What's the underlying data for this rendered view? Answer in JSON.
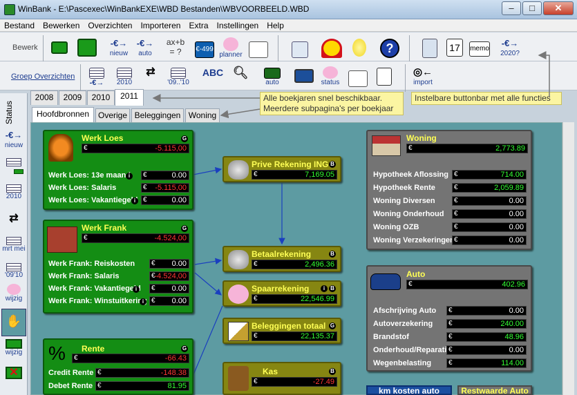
{
  "window": {
    "title": "WinBank - E:\\Pascexec\\WinBankEXE\\WBD Bestanden\\WBVOORBEELD.WBD"
  },
  "menu": [
    "Bestand",
    "Bewerken",
    "Overzichten",
    "Importeren",
    "Extra",
    "Instellingen",
    "Help"
  ],
  "toolbar1": {
    "label": "Bewerk",
    "nieuw": "nieuw",
    "auto": "auto",
    "formula": "ax+b = ?",
    "planner": "planner",
    "ebadge": "€-499",
    "year": "2020?"
  },
  "toolbar2": {
    "label": "Groep Overzichten",
    "y2010": "2010",
    "y0910": "'09..'10",
    "abc": "ABC",
    "auto": "auto",
    "status": "status",
    "import": "import",
    "calendar": "17",
    "memo": "memo"
  },
  "sidebar": {
    "status": "Status",
    "nieuw": "nieuw",
    "y2010": "2010",
    "mrt": "mrt",
    "mei": "mei",
    "y09": "'09",
    "y10": "'10",
    "wijzig1": "wijzig",
    "wijzig2": "wijzig"
  },
  "year_tabs": [
    "2008",
    "2009",
    "2010",
    "2011"
  ],
  "page_tabs": [
    "Hoofdbronnen",
    "Overige",
    "Beleggingen",
    "Woning"
  ],
  "callouts": {
    "c1a": "Alle boekjaren snel beschikbaar.",
    "c1b": "Meerdere subpagina's per boekjaar",
    "c2": "Instelbare buttonbar met alle functies"
  },
  "euro": "€",
  "werk_loes": {
    "title": "Werk Loes",
    "total": "-5.115,00",
    "rows": [
      {
        "label": "Werk Loes: 13e maand",
        "value": "0.00"
      },
      {
        "label": "Werk Loes: Salaris",
        "value": "-5.115,00"
      },
      {
        "label": "Werk Loes: Vakantiegeld",
        "value": "0.00"
      }
    ]
  },
  "werk_frank": {
    "title": "Werk Frank",
    "total": "-4.524,00",
    "rows": [
      {
        "label": "Werk Frank: Reiskosten",
        "value": "0.00"
      },
      {
        "label": "Werk Frank: Salaris",
        "value": "-4.524,00"
      },
      {
        "label": "Werk Frank: Vakantiegeld",
        "value": "0.00"
      },
      {
        "label": "Werk Frank: Winstuitkering",
        "value": "0.00"
      }
    ]
  },
  "rente": {
    "title": "Rente",
    "symbol": "%",
    "total": "-66.43",
    "rows": [
      {
        "label": "Credit Rente",
        "value": "-148.38"
      },
      {
        "label": "Debet Rente",
        "value": "81.95"
      }
    ]
  },
  "prive": {
    "title": "Prive Rekening ING",
    "value": "7,169.05"
  },
  "betaal": {
    "title": "Betaalrekening",
    "value": "2,496.36"
  },
  "spaar": {
    "title": "Spaarrekening",
    "value": "22,546.99"
  },
  "beleg": {
    "title": "Beleggingen totaal",
    "value": "22,135.37"
  },
  "kas": {
    "title": "Kas",
    "value": "-27.49"
  },
  "woning": {
    "title": "Woning",
    "total": "2,773.89",
    "rows": [
      {
        "label": "Hypotheek Aflossing",
        "value": "714.00"
      },
      {
        "label": "Hypotheek Rente",
        "value": "2,059.89"
      },
      {
        "label": "Woning Diversen",
        "value": "0.00"
      },
      {
        "label": "Woning Onderhoud",
        "value": "0.00"
      },
      {
        "label": "Woning OZB",
        "value": "0.00"
      },
      {
        "label": "Woning Verzekeringen",
        "value": "0.00"
      }
    ]
  },
  "auto": {
    "title": "Auto",
    "total": "402.96",
    "rows": [
      {
        "label": "Afschrijving Auto",
        "value": "0.00"
      },
      {
        "label": "Autoverzekering",
        "value": "240.00"
      },
      {
        "label": "Brandstof",
        "value": "48.96"
      },
      {
        "label": "Onderhoud/Reparatie",
        "value": "0.00"
      },
      {
        "label": "Wegenbelasting",
        "value": "114.00"
      }
    ]
  },
  "buttons": {
    "km": "km kosten auto",
    "rest": "Restwaarde Auto"
  },
  "badges": {
    "g": "G",
    "b": "B",
    "i": "i"
  }
}
